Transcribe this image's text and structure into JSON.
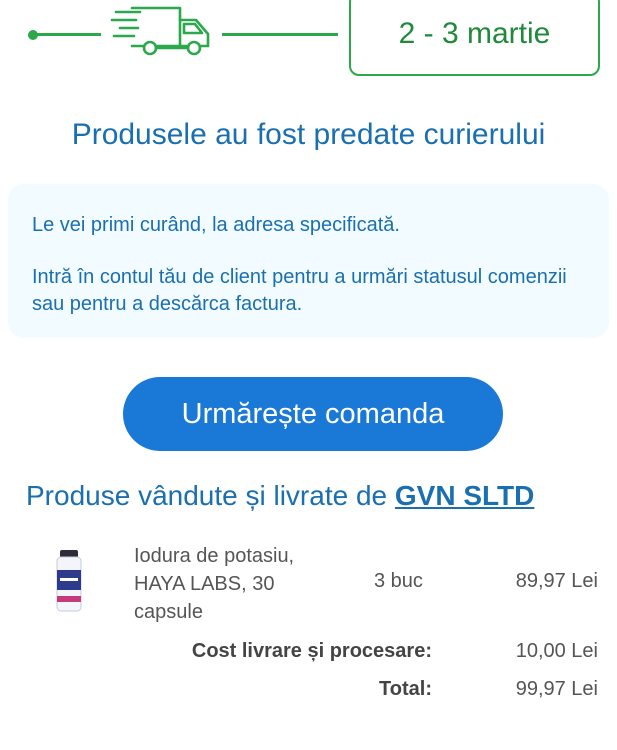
{
  "tracking": {
    "date_label": "2 - 3 martie",
    "truck_icon": "delivery-truck-icon",
    "accent_color": "#2aa84a"
  },
  "status": {
    "headline": "Produsele au fost predate curierului",
    "message_line1": "Le vei primi curând, la adresa specificată.",
    "message_line2": "Intră în contul tău de client pentru a urmări statusul comenzii sau pentru a descărca factura."
  },
  "actions": {
    "track_order_label": "Urmărește comanda"
  },
  "seller": {
    "prefix": "Produse vândute și livrate de ",
    "name": "GVN SLTD"
  },
  "items": [
    {
      "name": "Iodura de potasiu, HAYA LABS, 30 capsule",
      "quantity": "3 buc",
      "price": "89,97 Lei"
    }
  ],
  "totals": {
    "shipping_label": "Cost livrare și procesare:",
    "shipping_value": "10,00 Lei",
    "total_label": "Total:",
    "total_value": "99,97 Lei"
  }
}
